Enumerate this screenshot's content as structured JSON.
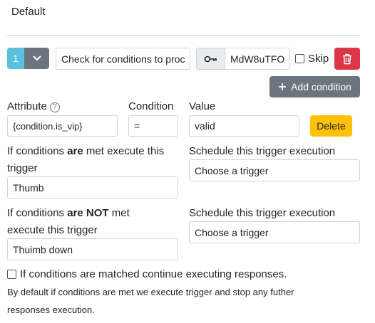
{
  "header": {
    "title": "Default"
  },
  "step": {
    "order_value": "1",
    "message_value": "Check for conditions to proc",
    "code_value": "MdW8uTFO",
    "skip_label": "Skip",
    "add_condition_label": "Add condition"
  },
  "condition": {
    "attribute_label": "Attribute",
    "condition_label": "Condition",
    "value_label": "Value",
    "attribute_value": "{condition.is_vip}",
    "condition_value": "=",
    "value_value": "valid",
    "delete_label": "Delete"
  },
  "met": {
    "pre": "If conditions ",
    "bold": "are",
    "post": " met execute this",
    "line2": "trigger",
    "trigger_value": "Thumb",
    "schedule_label": "Schedule this trigger execution",
    "schedule_value": "Choose a trigger"
  },
  "not_met": {
    "pre": "If conditions ",
    "bold": "are NOT",
    "post": " met",
    "line2": "execute this trigger",
    "trigger_value": "Thuimb down",
    "schedule_label": "Schedule this trigger execution",
    "schedule_value": "Choose a trigger"
  },
  "continue": {
    "label": "If conditions are matched continue executing responses.",
    "help_line1": "By default if conditions are met we execute trigger and stop any futher",
    "help_line2": "responses execution."
  },
  "icons": {
    "caret": "chevron-down-icon",
    "key": "key-icon",
    "trash": "trash-icon",
    "plus": "plus-icon",
    "help": "question-circle-icon"
  },
  "colors": {
    "info": "#5bc0de",
    "secondary": "#6c757d",
    "danger": "#dc3545",
    "warning": "#ffc107"
  }
}
